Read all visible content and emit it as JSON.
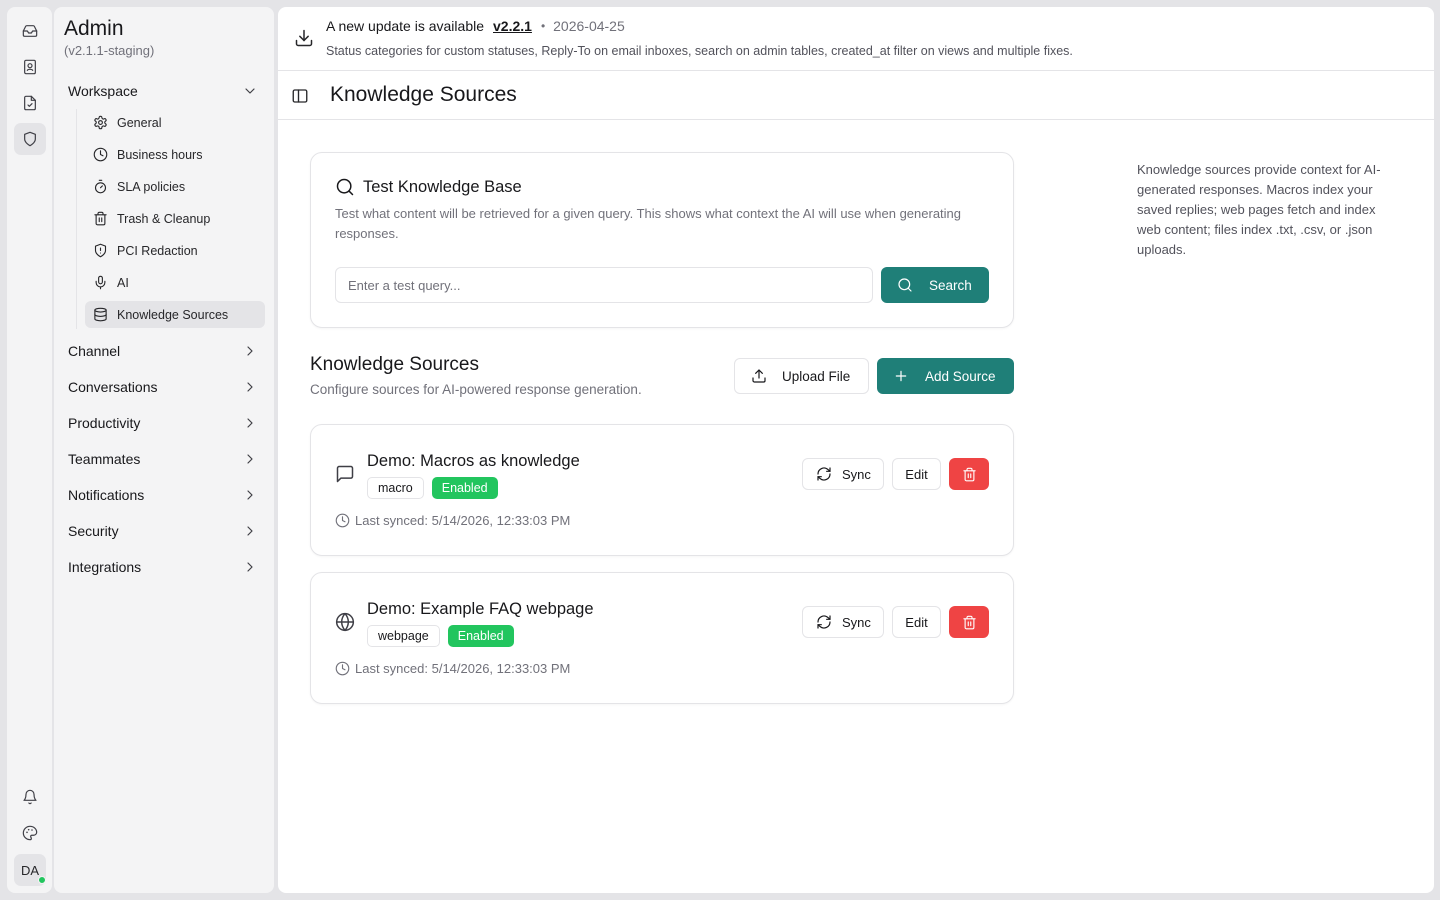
{
  "rail": {
    "items": [
      {
        "icon": "inbox-icon"
      },
      {
        "icon": "contacts-icon"
      },
      {
        "icon": "report-icon"
      },
      {
        "icon": "shield-icon"
      }
    ],
    "bottom": [
      {
        "icon": "bell-icon"
      },
      {
        "icon": "palette-icon"
      }
    ],
    "avatar_initials": "DA",
    "online_color": "#22c55e"
  },
  "sidebar": {
    "title": "Admin",
    "version": "(v2.1.1-staging)",
    "workspace_label": "Workspace",
    "workspace_items": [
      {
        "label": "General",
        "icon": "gear-icon"
      },
      {
        "label": "Business hours",
        "icon": "clock-icon"
      },
      {
        "label": "SLA policies",
        "icon": "timer-icon"
      },
      {
        "label": "Trash & Cleanup",
        "icon": "trash-icon"
      },
      {
        "label": "PCI Redaction",
        "icon": "shield-alert-icon"
      },
      {
        "label": "AI",
        "icon": "mic-icon"
      },
      {
        "label": "Knowledge Sources",
        "icon": "database-icon"
      }
    ],
    "sections": [
      "Channel",
      "Conversations",
      "Productivity",
      "Teammates",
      "Notifications",
      "Security",
      "Integrations"
    ]
  },
  "banner": {
    "text": "A new update is available",
    "version": "v2.2.1",
    "separator": "•",
    "date": "2026-04-25",
    "notes": "Status categories for custom statuses, Reply-To on email inboxes, search on admin tables, created_at filter on views and multiple fixes."
  },
  "header": {
    "title": "Knowledge Sources"
  },
  "test": {
    "title": "Test Knowledge Base",
    "description": "Test what content will be retrieved for a given query. This shows what context the AI will use when generating responses.",
    "placeholder": "Enter a test query...",
    "search_label": "Search"
  },
  "sources": {
    "title": "Knowledge Sources",
    "description": "Configure sources for AI-powered response generation.",
    "upload_label": "Upload File",
    "add_label": "Add Source",
    "items": [
      {
        "name": "Demo: Macros as knowledge",
        "type": "macro",
        "status": "Enabled",
        "last_synced": "Last synced: 5/14/2026, 12:33:03 PM",
        "icon": "message-square-icon",
        "sync_label": "Sync",
        "edit_label": "Edit"
      },
      {
        "name": "Demo: Example FAQ webpage",
        "type": "webpage",
        "status": "Enabled",
        "last_synced": "Last synced: 5/14/2026, 12:33:03 PM",
        "icon": "globe-icon",
        "sync_label": "Sync",
        "edit_label": "Edit"
      }
    ]
  },
  "info": "Knowledge sources provide context for AI-generated responses. Macros index your saved replies; web pages fetch and index web content; files index .txt, .csv, or .json uploads.",
  "colors": {
    "accent": "#1f7f78",
    "enabled": "#22c55e",
    "danger": "#ef4444"
  }
}
